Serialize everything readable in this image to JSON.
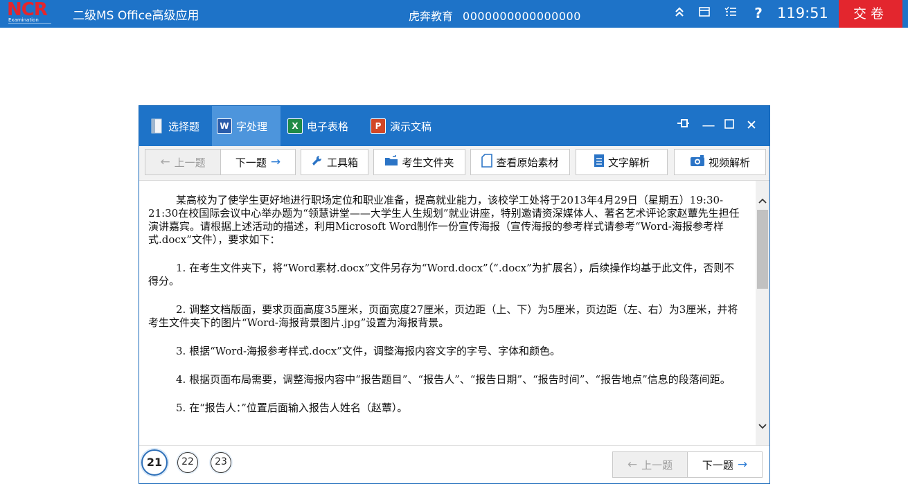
{
  "topbar": {
    "logo_text": "NCR",
    "logo_sub": "Examination",
    "app_title": "二级MS Office高级应用",
    "org": "虎奔教育",
    "exam_id": "0000000000000000",
    "icons": [
      "collapse-up-icon",
      "window-icon",
      "list-icon",
      "help-icon"
    ],
    "timer": "119:51",
    "submit_label": "交卷",
    "colors": {
      "bar": "#1e73c8",
      "submit": "#e3262e"
    }
  },
  "dialog": {
    "tabs": [
      {
        "label": "选择题",
        "icon": "document-icon"
      },
      {
        "label": "字处理",
        "icon": "word-icon"
      },
      {
        "label": "电子表格",
        "icon": "excel-icon"
      },
      {
        "label": "演示文稿",
        "icon": "powerpoint-icon"
      }
    ],
    "active_tab": "字处理",
    "toolbar": {
      "prev": "上一题",
      "next": "下一题",
      "tools": "工具箱",
      "folder": "考生文件夹",
      "source": "查看原始素材",
      "text_analysis": "文字解析",
      "video_analysis": "视频解析"
    },
    "paragraphs": [
      "某高校为了使学生更好地进行职场定位和职业准备，提高就业能力，该校学工处将于2013年4月29日（星期五）19:30-21:30在校国际会议中心举办题为“领慧讲堂——大学生人生规划”就业讲座，特别邀请资深媒体人、著名艺术评论家赵蕈先生担任演讲嘉宾。请根据上述活动的描述，利用Microsoft Word制作一份宣传海报（宣传海报的参考样式请参考“Word-海报参考样式.docx”文件），要求如下：",
      "1. 在考生文件夹下，将“Word素材.docx”文件另存为“Word.docx”（“.docx”为扩展名），后续操作均基于此文件，否则不得分。",
      "2. 调整文档版面，要求页面高度35厘米，页面宽度27厘米，页边距（上、下）为5厘米，页边距（左、右）为3厘米，并将考生文件夹下的图片“Word-海报背景图片.jpg”设置为海报背景。",
      "3. 根据“Word-海报参考样式.docx”文件，调整海报内容文字的字号、字体和颜色。",
      "4. 根据页面布局需要，调整海报内容中“报告题目”、“报告人”、“报告日期”、“报告时间”、“报告地点”信息的段落间距。",
      "5. 在“报告人：”位置后面输入报告人姓名（赵蕈）。"
    ],
    "footer": {
      "questions": [
        "21",
        "22",
        "23"
      ],
      "current_question": "21",
      "prev": "上一题",
      "next": "下一题"
    }
  }
}
